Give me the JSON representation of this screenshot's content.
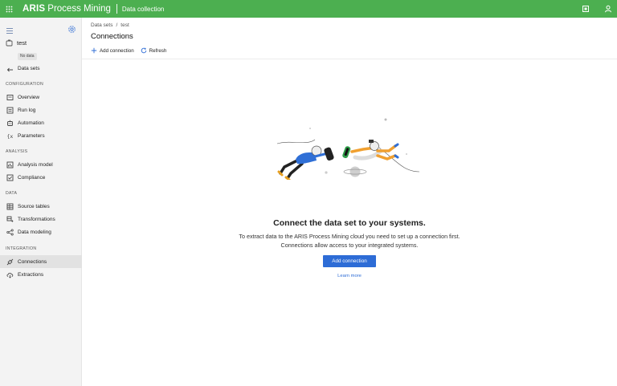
{
  "header": {
    "brand_bold": "ARIS",
    "brand_light": "Process Mining",
    "module": "Data collection",
    "icons": [
      "apps-grid-icon",
      "notifications-icon",
      "user-icon"
    ]
  },
  "sidebar": {
    "dataset_name": "test",
    "dataset_status": "No data",
    "back_label": "Data sets",
    "sections": {
      "configuration": "CONFIGURATION",
      "analysis": "ANALYSIS",
      "data": "DATA",
      "integration": "INTEGRATION"
    },
    "items": {
      "overview": "Overview",
      "run_log": "Run log",
      "automation": "Automation",
      "parameters": "Parameters",
      "analysis_model": "Analysis model",
      "compliance": "Compliance",
      "source_tables": "Source tables",
      "transformations": "Transformations",
      "data_modeling": "Data modeling",
      "connections": "Connections",
      "extractions": "Extractions"
    },
    "active_item": "Connections"
  },
  "main": {
    "breadcrumb": [
      "Data sets",
      "/",
      "test"
    ],
    "title": "Connections",
    "toolbar": {
      "add_connection": "Add connection",
      "refresh": "Refresh"
    },
    "empty_state": {
      "title": "Connect the data set to your systems.",
      "description": "To extract data to the ARIS Process Mining cloud you need to set up a connection first. Connections allow access to your integrated systems.",
      "primary_button": "Add connection",
      "link": "Learn more"
    }
  },
  "colors": {
    "header_green": "#4caf50",
    "primary_blue": "#2d6cd6",
    "sidebar_bg": "#f3f3f3",
    "active_item_bg": "#e2e2e2"
  }
}
